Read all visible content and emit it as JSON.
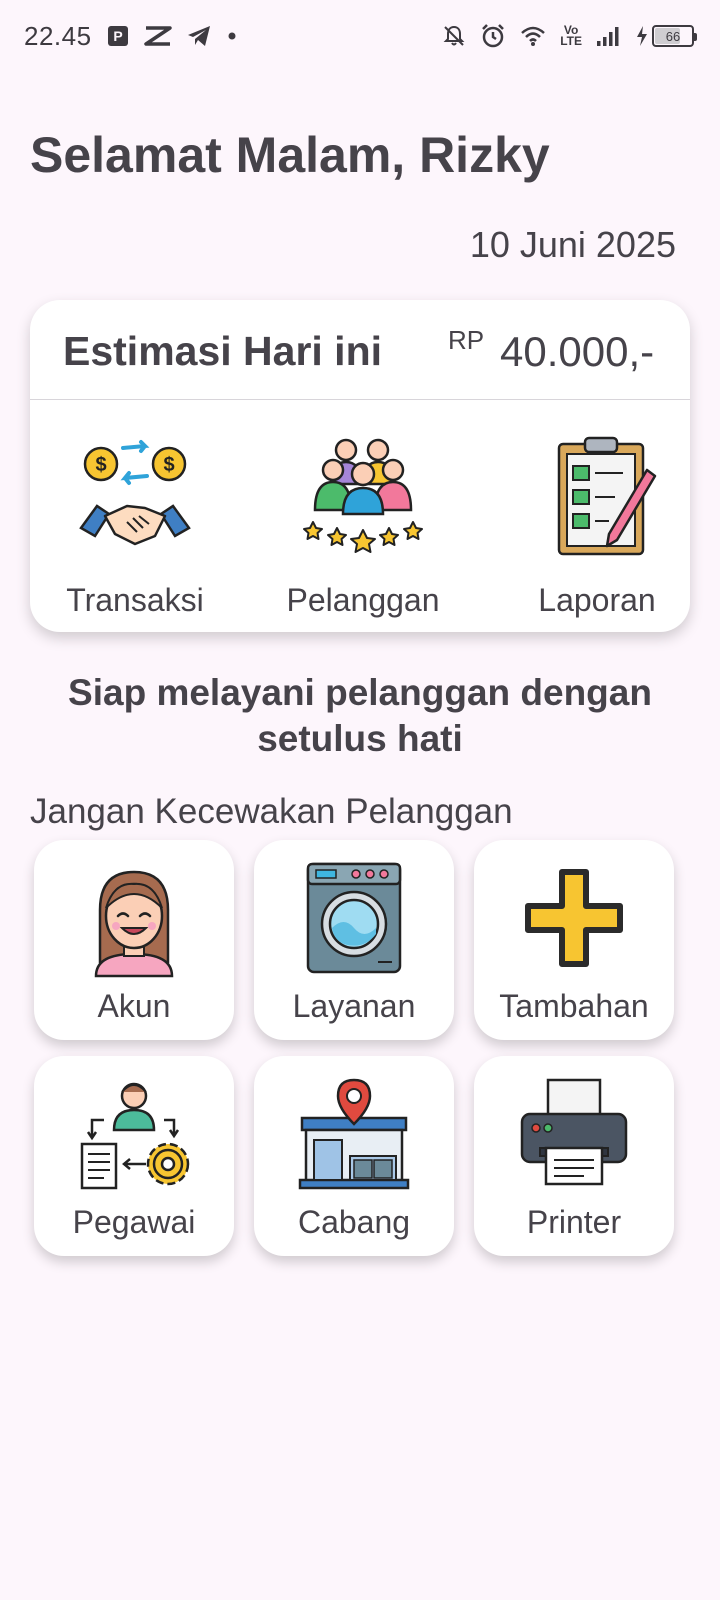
{
  "status_bar": {
    "time": "22.45",
    "network_label_top": "Vo",
    "network_label_bottom": "LTE",
    "battery_level": "66",
    "icons": [
      "parking-app-icon",
      "capcut-icon",
      "telegram-icon",
      "dot-icon",
      "mute-bell-icon",
      "alarm-icon",
      "wifi-icon",
      "volte-icon",
      "signal-icon",
      "charging-icon",
      "battery-icon"
    ]
  },
  "greeting": "Selamat Malam, Rizky",
  "date": "10 Juni 2025",
  "estimasi": {
    "title": "Estimasi Hari ini",
    "currency": "RP",
    "amount": "40.000,-"
  },
  "quick_actions": [
    {
      "label": "Transaksi",
      "icon": "handshake-money-icon"
    },
    {
      "label": "Pelanggan",
      "icon": "customers-stars-icon"
    },
    {
      "label": "Laporan",
      "icon": "clipboard-report-icon"
    }
  ],
  "tagline": "Siap melayani pelanggan dengan setulus hati",
  "subtitle": "Jangan Kecewakan Pelanggan",
  "menu": [
    {
      "label": "Akun",
      "icon": "user-avatar-icon"
    },
    {
      "label": "Layanan",
      "icon": "washing-machine-icon"
    },
    {
      "label": "Tambahan",
      "icon": "plus-icon"
    },
    {
      "label": "Pegawai",
      "icon": "employee-workflow-icon"
    },
    {
      "label": "Cabang",
      "icon": "store-location-icon"
    },
    {
      "label": "Printer",
      "icon": "printer-icon"
    }
  ],
  "colors": {
    "background": "#fdf6fc",
    "text": "#46434a",
    "card": "#ffffff",
    "accent_yellow": "#f7c531"
  }
}
